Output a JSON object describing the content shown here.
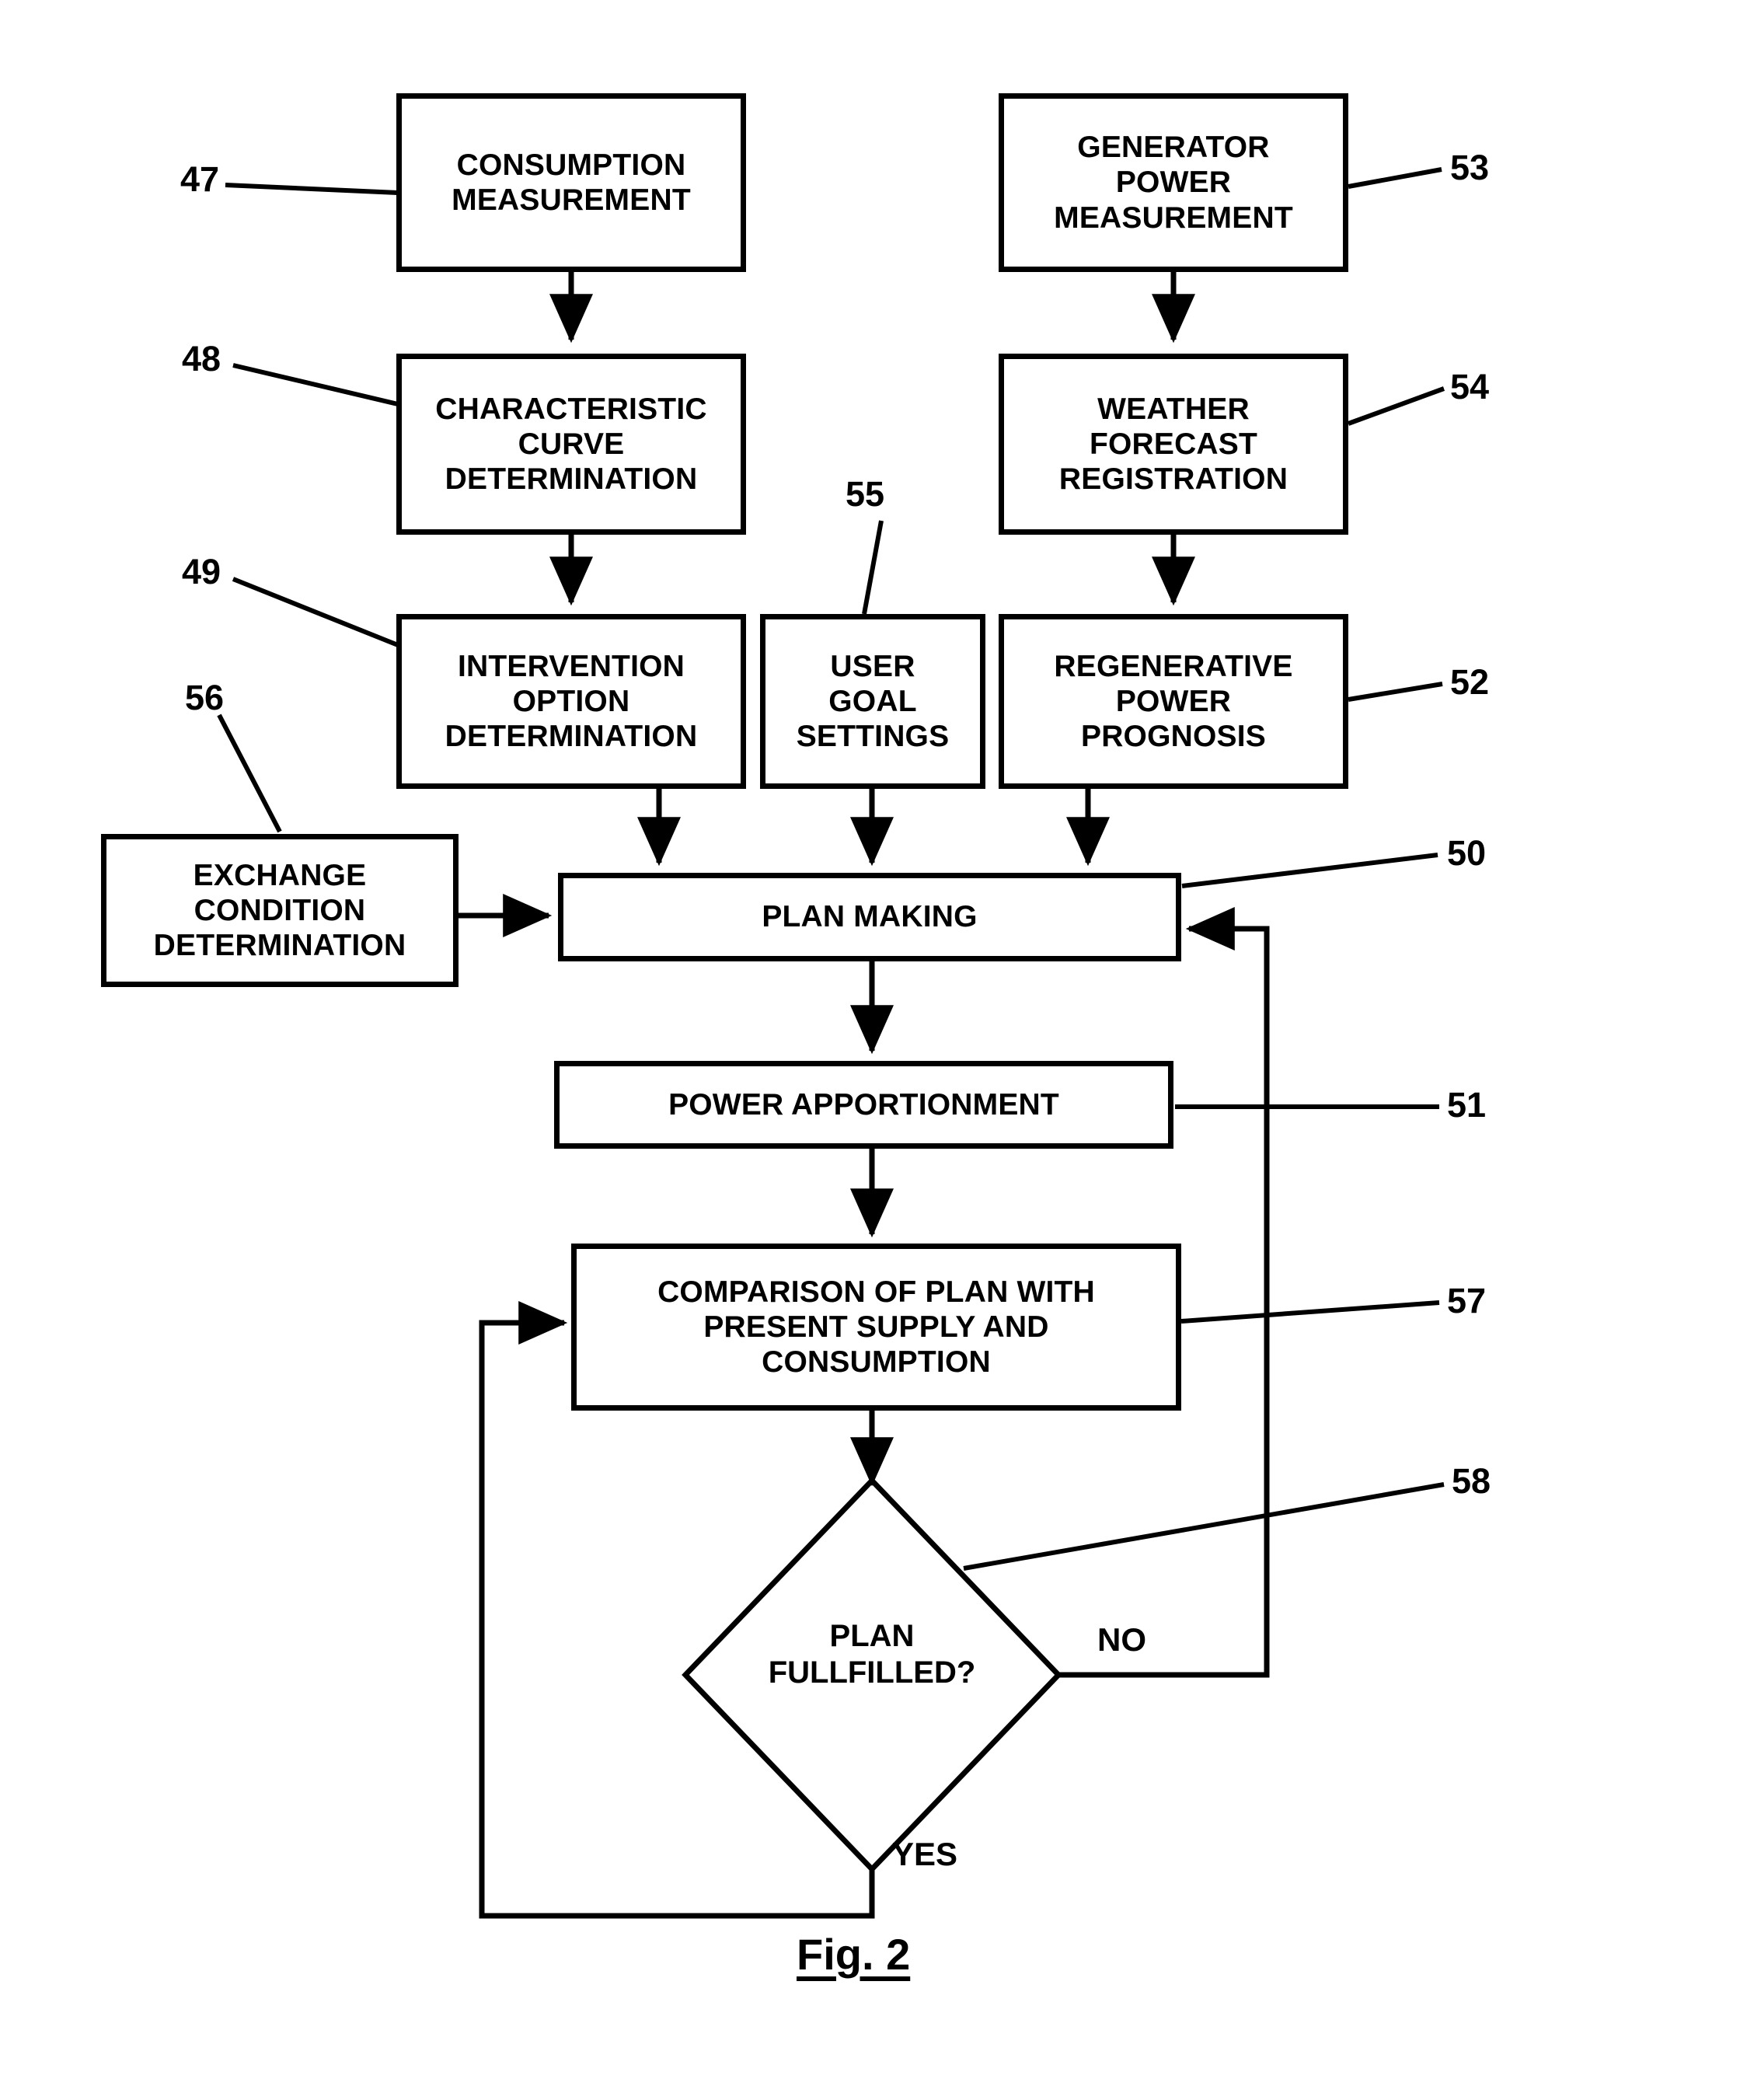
{
  "figure": {
    "caption": "Fig. 2",
    "type": "patent-flowchart"
  },
  "nodes": [
    {
      "id": "consumption_measurement",
      "label": "CONSUMPTION\nMEASUREMENT",
      "ref": "47"
    },
    {
      "id": "characteristic_curve_determination",
      "label": "CHARACTERISTIC\nCURVE\nDETERMINATION",
      "ref": "48"
    },
    {
      "id": "intervention_option_determination",
      "label": "INTERVENTION\nOPTION\nDETERMINATION",
      "ref": "49"
    },
    {
      "id": "user_goal_settings",
      "label": "USER\nGOAL\nSETTINGS",
      "ref": "55"
    },
    {
      "id": "generator_power_measurement",
      "label": "GENERATOR\nPOWER\nMEASUREMENT",
      "ref": "53"
    },
    {
      "id": "weather_forecast_registration",
      "label": "WEATHER\nFORECAST\nREGISTRATION",
      "ref": "54"
    },
    {
      "id": "regenerative_power_prognosis",
      "label": "REGENERATIVE\nPOWER\nPROGNOSIS",
      "ref": "52"
    },
    {
      "id": "exchange_condition_determination",
      "label": "EXCHANGE\nCONDITION\nDETERMINATION",
      "ref": "56"
    },
    {
      "id": "plan_making",
      "label": "PLAN MAKING",
      "ref": "50"
    },
    {
      "id": "power_apportionment",
      "label": "POWER APPORTIONMENT",
      "ref": "51"
    },
    {
      "id": "comparison_of_plan",
      "label": "COMPARISON OF PLAN WITH\nPRESENT SUPPLY AND\nCONSUMPTION",
      "ref": "57"
    },
    {
      "id": "plan_fullfilled_decision",
      "label": "PLAN\nFULLFILLED?",
      "ref": "58"
    }
  ],
  "ref_numbers": {
    "n47": "47",
    "n48": "48",
    "n49": "49",
    "n50": "50",
    "n51": "51",
    "n52": "52",
    "n53": "53",
    "n54": "54",
    "n55": "55",
    "n56": "56",
    "n57": "57",
    "n58": "58"
  },
  "edge_labels": {
    "yes": "YES",
    "no": "NO"
  },
  "colors": {
    "stroke": "#000000",
    "background": "#ffffff"
  }
}
